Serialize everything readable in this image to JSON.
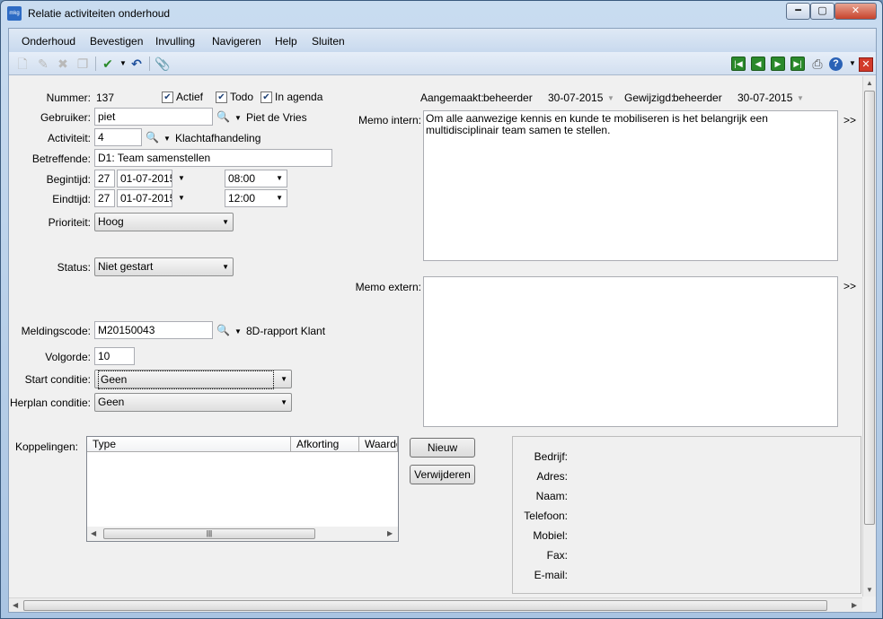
{
  "window": {
    "title": "Relatie activiteiten onderhoud",
    "app_icon_text": "mkg"
  },
  "menu": [
    "Onderhoud",
    "Bevestigen",
    "Invulling",
    "Navigeren",
    "Help",
    "Sluiten"
  ],
  "toolbar": {
    "left_icons": [
      "new-icon",
      "edit-icon",
      "delete-icon",
      "copy-icon",
      "confirm-icon",
      "undo-icon",
      "attach-icon"
    ],
    "right_icons": [
      "first-record-icon",
      "previous-record-icon",
      "next-record-icon",
      "last-record-icon",
      "print-icon",
      "help-icon",
      "close-icon"
    ]
  },
  "form": {
    "nummer": {
      "label": "Nummer:",
      "value": "137"
    },
    "actief": {
      "label": "Actief",
      "checked": true
    },
    "todo": {
      "label": "Todo",
      "checked": true
    },
    "in_agenda": {
      "label": "In agenda",
      "checked": true
    },
    "gebruiker": {
      "label": "Gebruiker:",
      "value": "piet",
      "name": "Piet de Vries"
    },
    "activiteit": {
      "label": "Activiteit:",
      "value": "4",
      "name": "Klachtafhandeling"
    },
    "betreffende": {
      "label": "Betreffende:",
      "value": "D1: Team samenstellen"
    },
    "begintijd": {
      "label": "Begintijd:",
      "week": "27",
      "date": "01-07-2015",
      "time": "08:00"
    },
    "eindtijd": {
      "label": "Eindtijd:",
      "week": "27",
      "date": "01-07-2015",
      "time": "12:00"
    },
    "prioriteit": {
      "label": "Prioriteit:",
      "value": "Hoog"
    },
    "status": {
      "label": "Status:",
      "value": "Niet gestart"
    },
    "meldingscode": {
      "label": "Meldingscode:",
      "value": "M20150043",
      "name": "8D-rapport Klant"
    },
    "volgorde": {
      "label": "Volgorde:",
      "value": "10"
    },
    "start_conditie": {
      "label": "Start conditie:",
      "value": "Geen"
    },
    "herplan_conditie": {
      "label": "Herplan conditie:",
      "value": "Geen"
    }
  },
  "audit": {
    "aangemaakt_label": "Aangemaakt:",
    "aangemaakt_user": "beheerder",
    "aangemaakt_date": "30-07-2015",
    "gewijzigd_label": "Gewijzigd:",
    "gewijzigd_user": "beheerder",
    "gewijzigd_date": "30-07-2015"
  },
  "memo_intern": {
    "label": "Memo intern:",
    "text": "Om alle aanwezige kennis en kunde te mobiliseren is het belangrijk een multidisciplinair team samen te stellen.",
    "expand": ">>"
  },
  "memo_extern": {
    "label": "Memo extern:",
    "text": "",
    "expand": ">>"
  },
  "koppelingen": {
    "label": "Koppelingen:",
    "columns": [
      "Type",
      "Afkorting",
      "Waarde"
    ],
    "rows": [],
    "new_button": "Nieuw",
    "delete_button": "Verwijderen"
  },
  "contact": {
    "bedrijf": "Bedrijf:",
    "adres": "Adres:",
    "naam": "Naam:",
    "telefoon": "Telefoon:",
    "mobiel": "Mobiel:",
    "fax": "Fax:",
    "email": "E-mail:"
  },
  "scroll_glyph": "|||"
}
